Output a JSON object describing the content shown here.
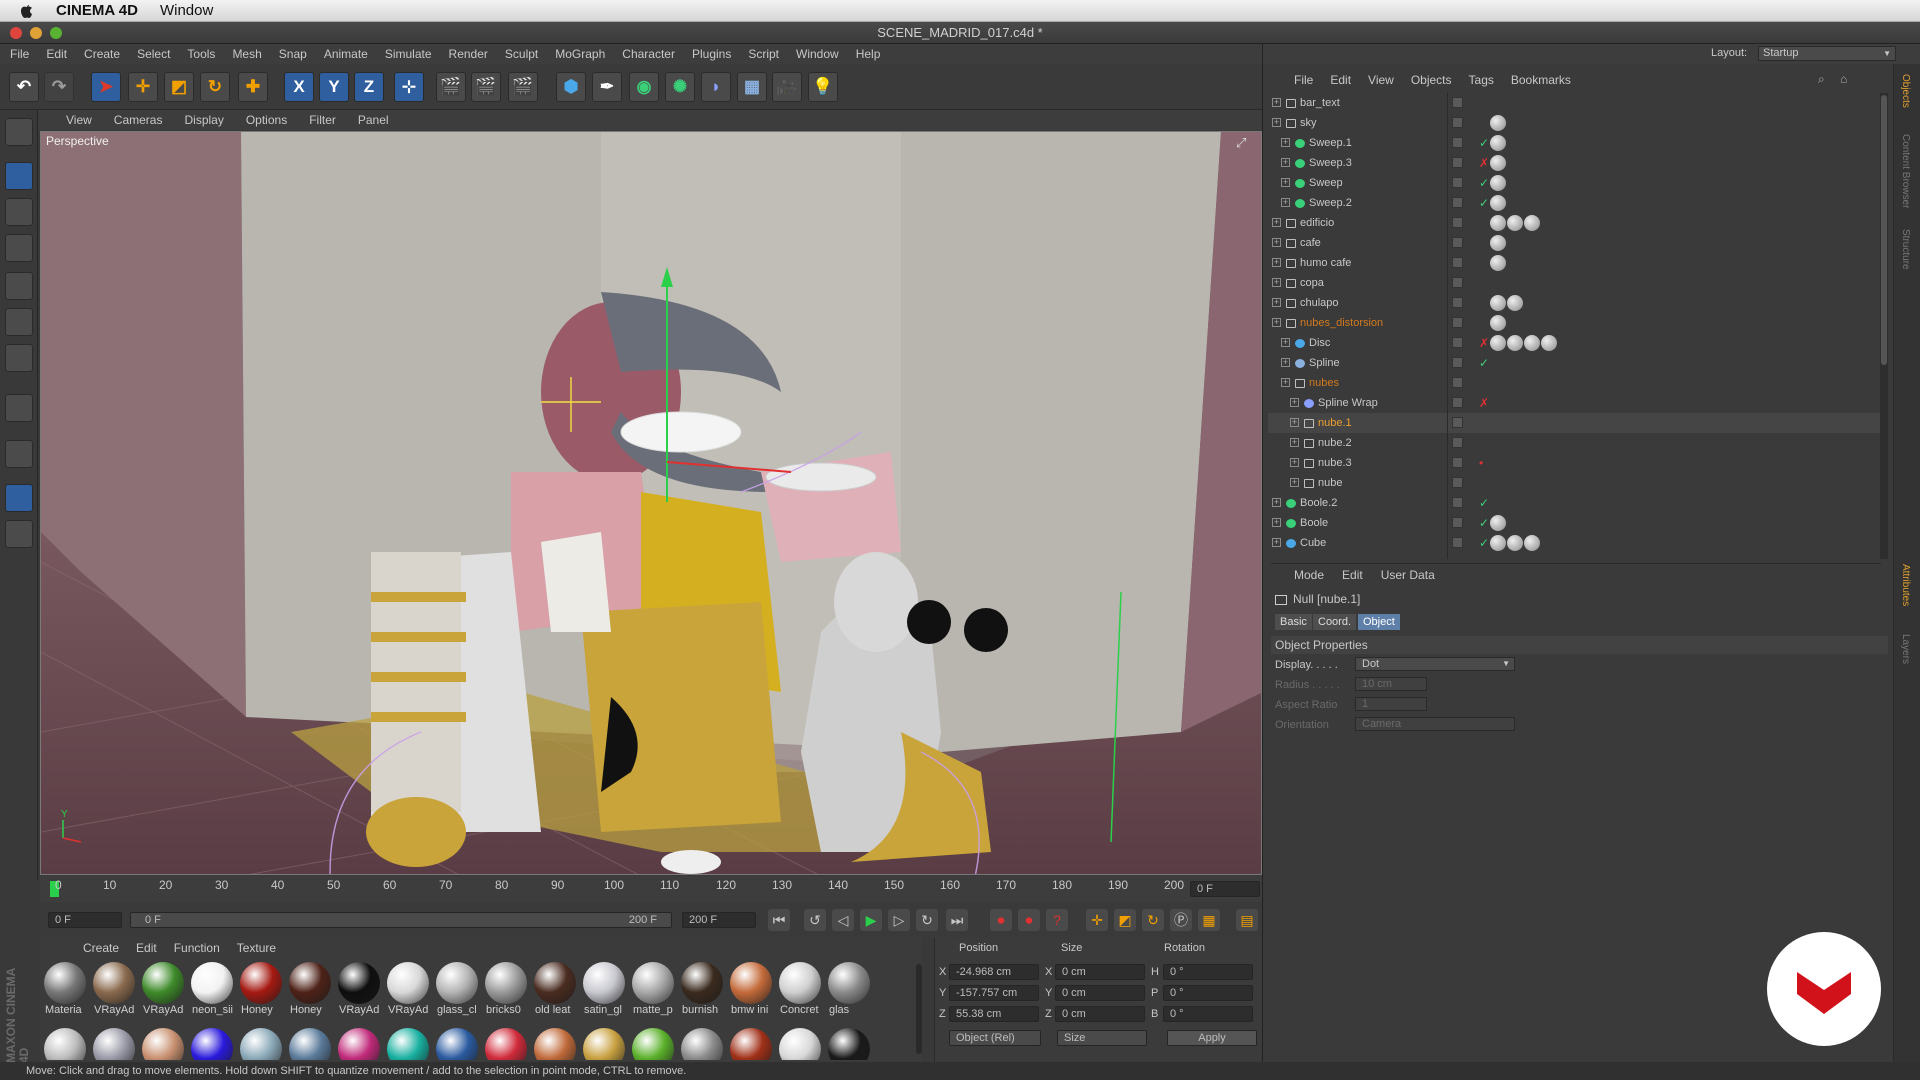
{
  "os_menu": {
    "app": "CINEMA 4D",
    "window": "Window"
  },
  "window": {
    "title": "SCENE_MADRID_017.c4d *"
  },
  "main_menu": [
    "File",
    "Edit",
    "Create",
    "Select",
    "Tools",
    "Mesh",
    "Snap",
    "Animate",
    "Simulate",
    "Render",
    "Sculpt",
    "MoGraph",
    "Character",
    "Plugins",
    "Script",
    "Window",
    "Help"
  ],
  "layout": {
    "label": "Layout:",
    "value": "Startup"
  },
  "toolbar": {
    "axis_x": "X",
    "axis_y": "Y",
    "axis_z": "Z"
  },
  "viewport": {
    "menu": [
      "View",
      "Cameras",
      "Display",
      "Options",
      "Filter",
      "Panel"
    ],
    "label": "Perspective",
    "axis_y": "Y"
  },
  "timeline": {
    "ticks": [
      "0",
      "10",
      "20",
      "30",
      "40",
      "50",
      "60",
      "70",
      "80",
      "90",
      "100",
      "110",
      "120",
      "130",
      "140",
      "150",
      "160",
      "170",
      "180",
      "190",
      "200"
    ],
    "current_frame": "0 F",
    "start_field": "0 F",
    "range_start": "0 F",
    "range_end": "200 F",
    "end_field": "200 F"
  },
  "materials": {
    "menu": [
      "Create",
      "Edit",
      "Function",
      "Texture"
    ],
    "row1": [
      {
        "label": "Materia",
        "color": "#777777"
      },
      {
        "label": "VRayAd",
        "color": "#8a6a4e"
      },
      {
        "label": "VRayAd",
        "color": "#3e8a2a"
      },
      {
        "label": "neon_sii",
        "color": "#f2f2f2"
      },
      {
        "label": "Honey",
        "color": "#a51a12"
      },
      {
        "label": "Honey",
        "color": "#4e2218"
      },
      {
        "label": "VRayAd",
        "color": "#0e0e0e"
      },
      {
        "label": "VRayAd",
        "color": "#d8d8d8"
      },
      {
        "label": "glass_cl",
        "color": "#b4b4b4"
      },
      {
        "label": "bricks0",
        "color": "#9a9a9a"
      },
      {
        "label": "old leat",
        "color": "#4a2c20"
      },
      {
        "label": "satin_gl",
        "color": "#c8c8d0"
      },
      {
        "label": "matte_p",
        "color": "#a8a8a8"
      },
      {
        "label": "burnish",
        "color": "#3a2a1e"
      },
      {
        "label": "bmw ini",
        "color": "#c46a3a"
      },
      {
        "label": "Concret",
        "color": "#cfcfcf"
      },
      {
        "label": "glas",
        "color": "#8a8a8a"
      }
    ],
    "row2_colors": [
      "#bcbcbc",
      "#9a9aa8",
      "#c89070",
      "#2a1adc",
      "#8aa8b8",
      "#5a7a9a",
      "#c02a7a",
      "#18b0a0",
      "#2a5aa0",
      "#d02a3a",
      "#c06a3a",
      "#c8a040",
      "#5ab02a",
      "#8a8a8a",
      "#a03018",
      "#d8d8d8",
      "#1a1a1a"
    ]
  },
  "coords": {
    "headers": [
      "Position",
      "Size",
      "Rotation"
    ],
    "rows": [
      {
        "axis": "X",
        "pos": "-24.968 cm",
        "size_axis": "X",
        "size": "0 cm",
        "rot_axis": "H",
        "rot": "0 °"
      },
      {
        "axis": "Y",
        "pos": "-157.757 cm",
        "size_axis": "Y",
        "size": "0 cm",
        "rot_axis": "P",
        "rot": "0 °"
      },
      {
        "axis": "Z",
        "pos": "55.38 cm",
        "size_axis": "Z",
        "size": "0 cm",
        "rot_axis": "B",
        "rot": "0 °"
      }
    ],
    "mode_dropdown": "Object (Rel)",
    "size_dropdown": "Size",
    "apply": "Apply"
  },
  "status": "Move: Click and drag to move elements. Hold down SHIFT to quantize movement / add to the selection in point mode, CTRL to remove.",
  "brand": "MAXON CINEMA 4D",
  "objects": {
    "menu": [
      "File",
      "Edit",
      "View",
      "Objects",
      "Tags",
      "Bookmarks"
    ],
    "rows": [
      {
        "name": "bar_text",
        "indent": 0,
        "type": "null",
        "chk": "",
        "tags": 0,
        "color": ""
      },
      {
        "name": "sky",
        "indent": 0,
        "type": "null",
        "chk": "",
        "tags": 1,
        "color": ""
      },
      {
        "name": "Sweep.1",
        "indent": 1,
        "type": "sweep",
        "chk": "✓",
        "tags": 1,
        "color": ""
      },
      {
        "name": "Sweep.3",
        "indent": 1,
        "type": "sweep",
        "chk": "✗",
        "tags": 1,
        "color": ""
      },
      {
        "name": "Sweep",
        "indent": 1,
        "type": "sweep",
        "chk": "✓",
        "tags": 1,
        "color": ""
      },
      {
        "name": "Sweep.2",
        "indent": 1,
        "type": "sweep",
        "chk": "✓",
        "tags": 1,
        "color": ""
      },
      {
        "name": "edificio",
        "indent": 0,
        "type": "null",
        "chk": "",
        "tags": 3,
        "color": ""
      },
      {
        "name": "cafe",
        "indent": 0,
        "type": "null",
        "chk": "",
        "tags": 1,
        "color": ""
      },
      {
        "name": "humo cafe",
        "indent": 0,
        "type": "null",
        "chk": "",
        "tags": 1,
        "color": ""
      },
      {
        "name": "copa",
        "indent": 0,
        "type": "null",
        "chk": "",
        "tags": 0,
        "color": ""
      },
      {
        "name": "chulapo",
        "indent": 0,
        "type": "null",
        "chk": "",
        "tags": 2,
        "color": ""
      },
      {
        "name": "nubes_distorsion",
        "indent": 0,
        "type": "null",
        "chk": "",
        "tags": 1,
        "color": "#d27a1e"
      },
      {
        "name": "Disc",
        "indent": 1,
        "type": "disc",
        "chk": "✗",
        "tags": 4,
        "color": ""
      },
      {
        "name": "Spline",
        "indent": 1,
        "type": "spline",
        "chk": "✓",
        "tags": 0,
        "color": ""
      },
      {
        "name": "nubes",
        "indent": 1,
        "type": "null",
        "chk": "",
        "tags": 0,
        "color": "#d27a1e"
      },
      {
        "name": "Spline Wrap",
        "indent": 2,
        "type": "wrap",
        "chk": "✗",
        "tags": 0,
        "color": ""
      },
      {
        "name": "nube.1",
        "indent": 2,
        "type": "null",
        "chk": "",
        "tags": 0,
        "color": "#f0a030"
      },
      {
        "name": "nube.2",
        "indent": 2,
        "type": "null",
        "chk": "",
        "tags": 0,
        "color": ""
      },
      {
        "name": "nube.3",
        "indent": 2,
        "type": "null",
        "chk": "•",
        "tags": 0,
        "color": ""
      },
      {
        "name": "nube",
        "indent": 2,
        "type": "null",
        "chk": "",
        "tags": 0,
        "color": ""
      },
      {
        "name": "Boole.2",
        "indent": 0,
        "type": "boole",
        "chk": "✓",
        "tags": 0,
        "color": ""
      },
      {
        "name": "Boole",
        "indent": 0,
        "type": "boole",
        "chk": "✓",
        "tags": 1,
        "color": ""
      },
      {
        "name": "Cube",
        "indent": 0,
        "type": "cube",
        "chk": "✓",
        "tags": 3,
        "color": ""
      }
    ]
  },
  "attributes": {
    "menu": [
      "Mode",
      "Edit",
      "User Data"
    ],
    "title": "Null [nube.1]",
    "tabs": [
      "Basic",
      "Coord.",
      "Object"
    ],
    "section": "Object Properties",
    "props": [
      {
        "label": "Display. . . . .",
        "value": "Dot",
        "enabled": true
      },
      {
        "label": "Radius . . . . .",
        "value": "10 cm",
        "enabled": false
      },
      {
        "label": "Aspect Ratio",
        "value": "1",
        "enabled": false
      },
      {
        "label": "Orientation",
        "value": "Camera",
        "enabled": false
      }
    ]
  },
  "side_tabs": [
    "Objects",
    "Content Browser",
    "Structure",
    "Attributes",
    "Layers"
  ]
}
